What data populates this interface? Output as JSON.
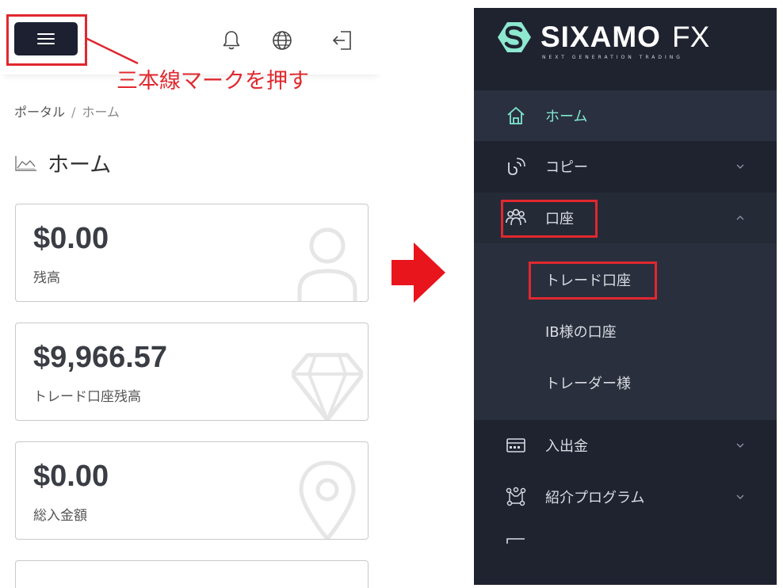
{
  "annotation": {
    "text": "三本線マークを押す"
  },
  "left": {
    "breadcrumb": {
      "root": "ポータル",
      "separator": "/",
      "current": "ホーム"
    },
    "page_title": "ホーム",
    "cards": [
      {
        "value": "$0.00",
        "label": "残高",
        "icon": "user-icon"
      },
      {
        "value": "$9,966.57",
        "label": "トレード口座残高",
        "icon": "diamond-icon"
      },
      {
        "value": "$0.00",
        "label": "総入金額",
        "icon": "location-pin-icon"
      }
    ],
    "header_icons": [
      "menu-icon",
      "bell-icon",
      "globe-icon",
      "logout-icon"
    ]
  },
  "right": {
    "logo": {
      "name": "SIXAMO",
      "suffix": "FX",
      "tagline": "NEXT GENERATION TRADING"
    },
    "menu": {
      "home": "ホーム",
      "copy": "コピー",
      "accounts": "口座",
      "accounts_sub": [
        "トレード口座",
        "IB様の口座",
        "トレーダー様"
      ],
      "deposit": "入出金",
      "referral": "紹介プログラム"
    }
  },
  "colors": {
    "highlight": "#e0282f",
    "sidebar_bg": "#1f2330",
    "accent": "#7fe7cf",
    "menu_btn": "#1d2030"
  }
}
